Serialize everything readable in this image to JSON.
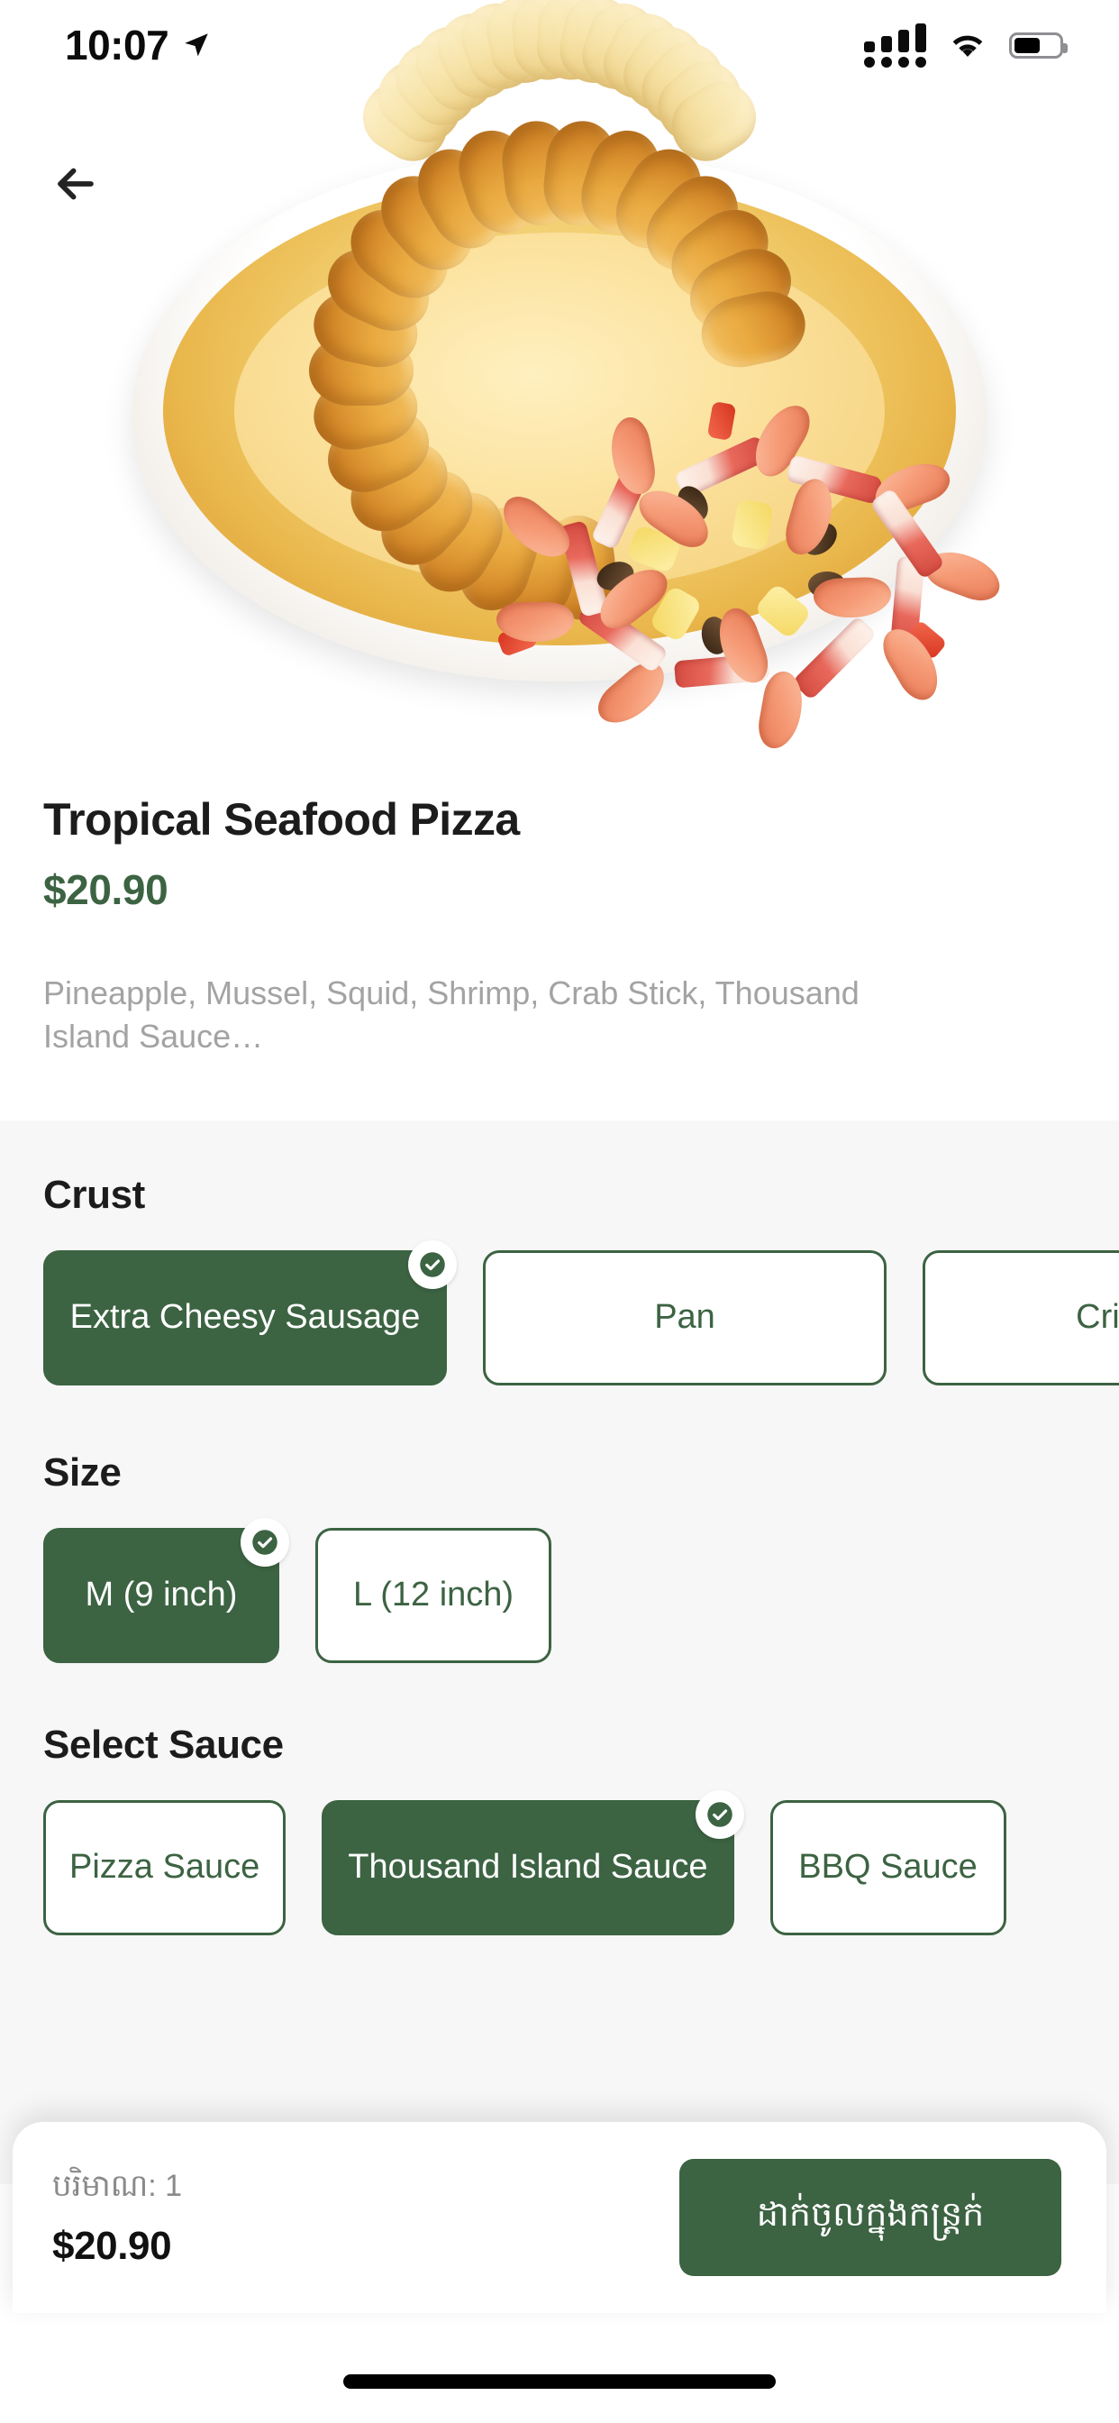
{
  "status_bar": {
    "time": "10:07",
    "location_icon": "location-arrow-icon",
    "signal_icon": "cellular-signal-icon",
    "wifi_icon": "wifi-icon",
    "battery_icon": "battery-icon",
    "battery_level_pct": 55
  },
  "nav": {
    "back_icon": "back-arrow-icon"
  },
  "product": {
    "image_alt": "tropical seafood pizza with cheesy sausage crust",
    "title": "Tropical Seafood Pizza",
    "price": "$20.90",
    "description": "Pineapple, Mussel, Squid, Shrimp, Crab Stick, Thousand Island Sauce…"
  },
  "options": {
    "crust": {
      "title": "Crust",
      "items": [
        {
          "label": "Extra Cheesy Sausage",
          "selected": true
        },
        {
          "label": "Pan",
          "selected": false
        },
        {
          "label": "Crispy",
          "selected": false
        }
      ]
    },
    "size": {
      "title": "Size",
      "items": [
        {
          "label": "M (9 inch)",
          "selected": true
        },
        {
          "label": "L (12 inch)",
          "selected": false
        }
      ]
    },
    "sauce": {
      "title": "Select Sauce",
      "items": [
        {
          "label": "Pizza Sauce",
          "selected": false
        },
        {
          "label": "Thousand Island Sauce",
          "selected": true
        },
        {
          "label": "BBQ Sauce",
          "selected": false
        }
      ]
    }
  },
  "bottom_bar": {
    "quantity_label": "បរិមាណ: 1",
    "total_price": "$20.90",
    "add_to_cart_label": "ដាក់ចូលក្នុងកន្ត្រក់"
  },
  "colors": {
    "brand_green": "#3c6342",
    "panel_bg": "#f7f7f7",
    "muted_text": "#a3a3a3",
    "title_text": "#1c1c1c"
  }
}
